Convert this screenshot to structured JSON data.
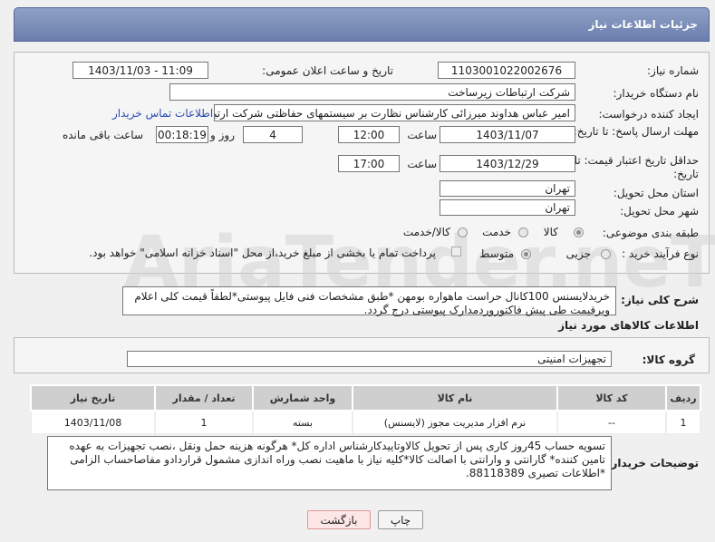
{
  "header": {
    "title": "جزئیات اطلاعات نیاز"
  },
  "form": {
    "need_number_label": "شماره نیاز:",
    "need_number": "1103001022002676",
    "announce_label": "تاریخ و ساعت اعلان عمومی:",
    "announce_value": "1403/11/03 - 11:09",
    "buyer_org_label": "نام دستگاه خریدار:",
    "buyer_org": "شرکت ارتباطات زیرساخت",
    "creator_label": "ایجاد کننده درخواست:",
    "creator": "امیر عباس هداوند میرزائی کارشناس نظارت بر سیستمهای حفاظتی شرکت ارتبا",
    "contact_link": "اطلاعات تماس خریدار",
    "reply_deadline_label": "مهلت ارسال پاسخ: تا تاریخ:",
    "reply_date": "1403/11/07",
    "time_label": "ساعت",
    "reply_time": "12:00",
    "days_value": "4",
    "days_label": "روز و",
    "remaining_time": "00:18:19",
    "remaining_label": "ساعت باقی مانده",
    "validity_label": "حداقل تاریخ اعتبار قیمت: تا تاریخ:",
    "validity_date": "1403/12/29",
    "validity_time": "17:00",
    "province_label": "استان محل تحویل:",
    "province": "تهران",
    "city_label": "شهر محل تحویل:",
    "city": "تهران",
    "category_label": "طبقه بندی موضوعی:",
    "category_options": [
      "کالا",
      "خدمت",
      "کالا/خدمت"
    ],
    "purchase_type_label": "نوع فرآیند خرید :",
    "purchase_options": [
      "جزیی",
      "متوسط"
    ],
    "payment_note": "پرداخت تمام یا بخشی از مبلغ خرید،از محل \"اسناد خزانه اسلامی\" خواهد بود."
  },
  "summary": {
    "label": "شرح کلی نیاز:",
    "text": "خریدلایسنس 100کانال حراست ماهواره بومهن *طبق مشخصات فنی فایل پیوستی*لطفاً قیمت کلی اعلام وبرقیمت طی پیش فاکتوروردمدارک پیوستی درج گردد."
  },
  "goods": {
    "section_title": "اطلاعات کالاهای مورد نیاز",
    "group_label": "گروه کالا:",
    "group_value": "تجهیزات امنیتی",
    "columns": [
      "ردیف",
      "کد کالا",
      "نام کالا",
      "واحد شمارش",
      "تعداد / مقدار",
      "تاریخ نیاز"
    ],
    "rows": [
      {
        "row": "1",
        "code": "--",
        "name": "نرم افزار مدیریت مجوز (لایسنس)",
        "unit": "بسته",
        "qty": "1",
        "date": "1403/11/08"
      }
    ]
  },
  "buyer_notes": {
    "label": "توضیحات خریدار:",
    "text": "تسویه حساب 45روز کاری پس از تحویل کالاوتاییدکارشناس اداره کل* هرگونه هزینه حمل ونقل ،نصب تجهیزات به عهده تامین کننده* گارانتی و وارانتی با اصالت کالا*کلیه نیاز با ماهیت نصب وراه اندازی مشمول قراردادو مفاصاحساب الزامی *اطلاعات تصیری 88118389."
  },
  "buttons": {
    "print": "چاپ",
    "back": "بازگشت"
  },
  "watermark": "AriaTender.neT"
}
